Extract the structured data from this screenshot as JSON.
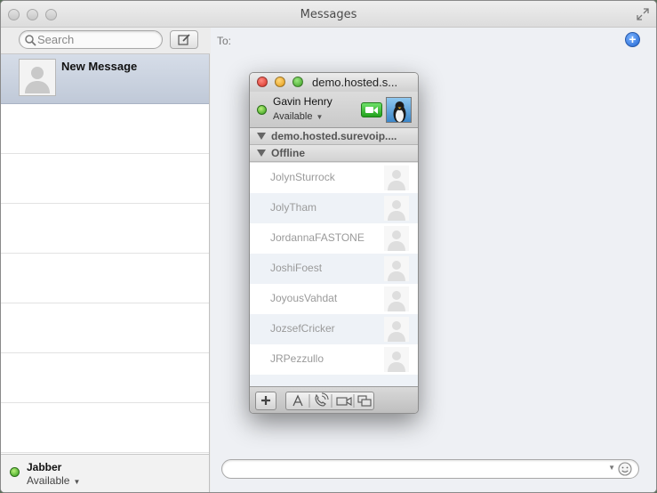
{
  "app": {
    "title": "Messages"
  },
  "sidebar": {
    "search_placeholder": "Search",
    "conversations": [
      {
        "name": "New Message",
        "selected": true
      }
    ]
  },
  "account": {
    "name": "Jabber",
    "status": "Available"
  },
  "main": {
    "to_label": "To:"
  },
  "buddy_window": {
    "title": "demo.hosted.s...",
    "user_name": "Gavin Henry",
    "user_status": "Available",
    "groups": [
      {
        "label": "demo.hosted.surevoip...."
      },
      {
        "label": "Offline"
      }
    ],
    "buddies": [
      "JolynSturrock",
      "JolyTham",
      "JordannaFASTONE",
      "JoshiFoest",
      "JoyousVahdat",
      "JozsefCricker",
      "JRPezzullo"
    ]
  },
  "colors": {
    "status_green": "#3cab1f",
    "accent_blue": "#1f64d2",
    "selected_row": "#c8d1de"
  }
}
